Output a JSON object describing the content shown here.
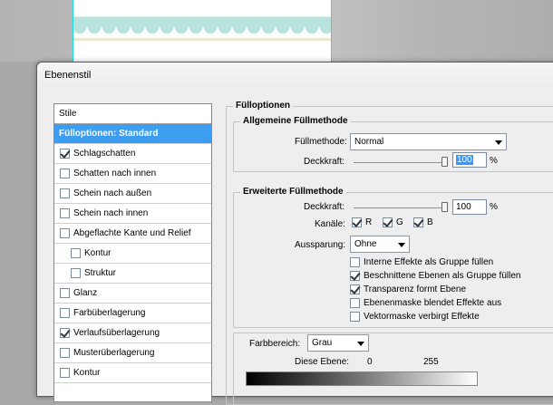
{
  "dialog": {
    "title": "Ebenenstil"
  },
  "styles": {
    "header": "Stile",
    "items": [
      {
        "label": "Fülloptionen: Standard",
        "checkbox": false,
        "active": true,
        "sub": false
      },
      {
        "label": "Schlagschatten",
        "checkbox": true,
        "checked": true,
        "sub": false
      },
      {
        "label": "Schatten nach innen",
        "checkbox": true,
        "checked": false,
        "sub": false
      },
      {
        "label": "Schein nach außen",
        "checkbox": true,
        "checked": false,
        "sub": false
      },
      {
        "label": "Schein nach innen",
        "checkbox": true,
        "checked": false,
        "sub": false
      },
      {
        "label": "Abgeflachte Kante und Relief",
        "checkbox": true,
        "checked": false,
        "sub": false
      },
      {
        "label": "Kontur",
        "checkbox": true,
        "checked": false,
        "sub": true
      },
      {
        "label": "Struktur",
        "checkbox": true,
        "checked": false,
        "sub": true
      },
      {
        "label": "Glanz",
        "checkbox": true,
        "checked": false,
        "sub": false
      },
      {
        "label": "Farbüberlagerung",
        "checkbox": true,
        "checked": false,
        "sub": false
      },
      {
        "label": "Verlaufsüberlagerung",
        "checkbox": true,
        "checked": true,
        "sub": false
      },
      {
        "label": "Musterüberlagerung",
        "checkbox": true,
        "checked": false,
        "sub": false
      },
      {
        "label": "Kontur",
        "checkbox": true,
        "checked": false,
        "sub": false
      }
    ]
  },
  "fill_options": {
    "title": "Fülloptionen",
    "general": {
      "title": "Allgemeine Füllmethode",
      "blend_mode_label": "Füllmethode:",
      "blend_mode_value": "Normal",
      "opacity_label": "Deckkraft:",
      "opacity_value": "100",
      "opacity_unit": "%",
      "opacity_fraction": 1.0
    },
    "advanced": {
      "title": "Erweiterte Füllmethode",
      "fill_opacity_label": "Deckkraft:",
      "fill_opacity_value": "100",
      "fill_opacity_unit": "%",
      "fill_opacity_fraction": 1.0,
      "channels_label": "Kanäle:",
      "channels": [
        {
          "label": "R",
          "checked": true
        },
        {
          "label": "G",
          "checked": true
        },
        {
          "label": "B",
          "checked": true
        }
      ],
      "knockout_label": "Aussparung:",
      "knockout_value": "Ohne",
      "options": [
        {
          "label": "Interne Effekte als Gruppe füllen",
          "checked": false
        },
        {
          "label": "Beschnittene Ebenen als Gruppe füllen",
          "checked": true
        },
        {
          "label": "Transparenz formt Ebene",
          "checked": true
        },
        {
          "label": "Ebenenmaske blendet Effekte aus",
          "checked": false
        },
        {
          "label": "Vektormaske verbirgt Effekte",
          "checked": false
        }
      ]
    },
    "blend_if": {
      "label": "Farbbereich:",
      "value": "Grau",
      "this_layer_label": "Diese Ebene:",
      "this_layer_min": "0",
      "this_layer_max": "255"
    }
  }
}
